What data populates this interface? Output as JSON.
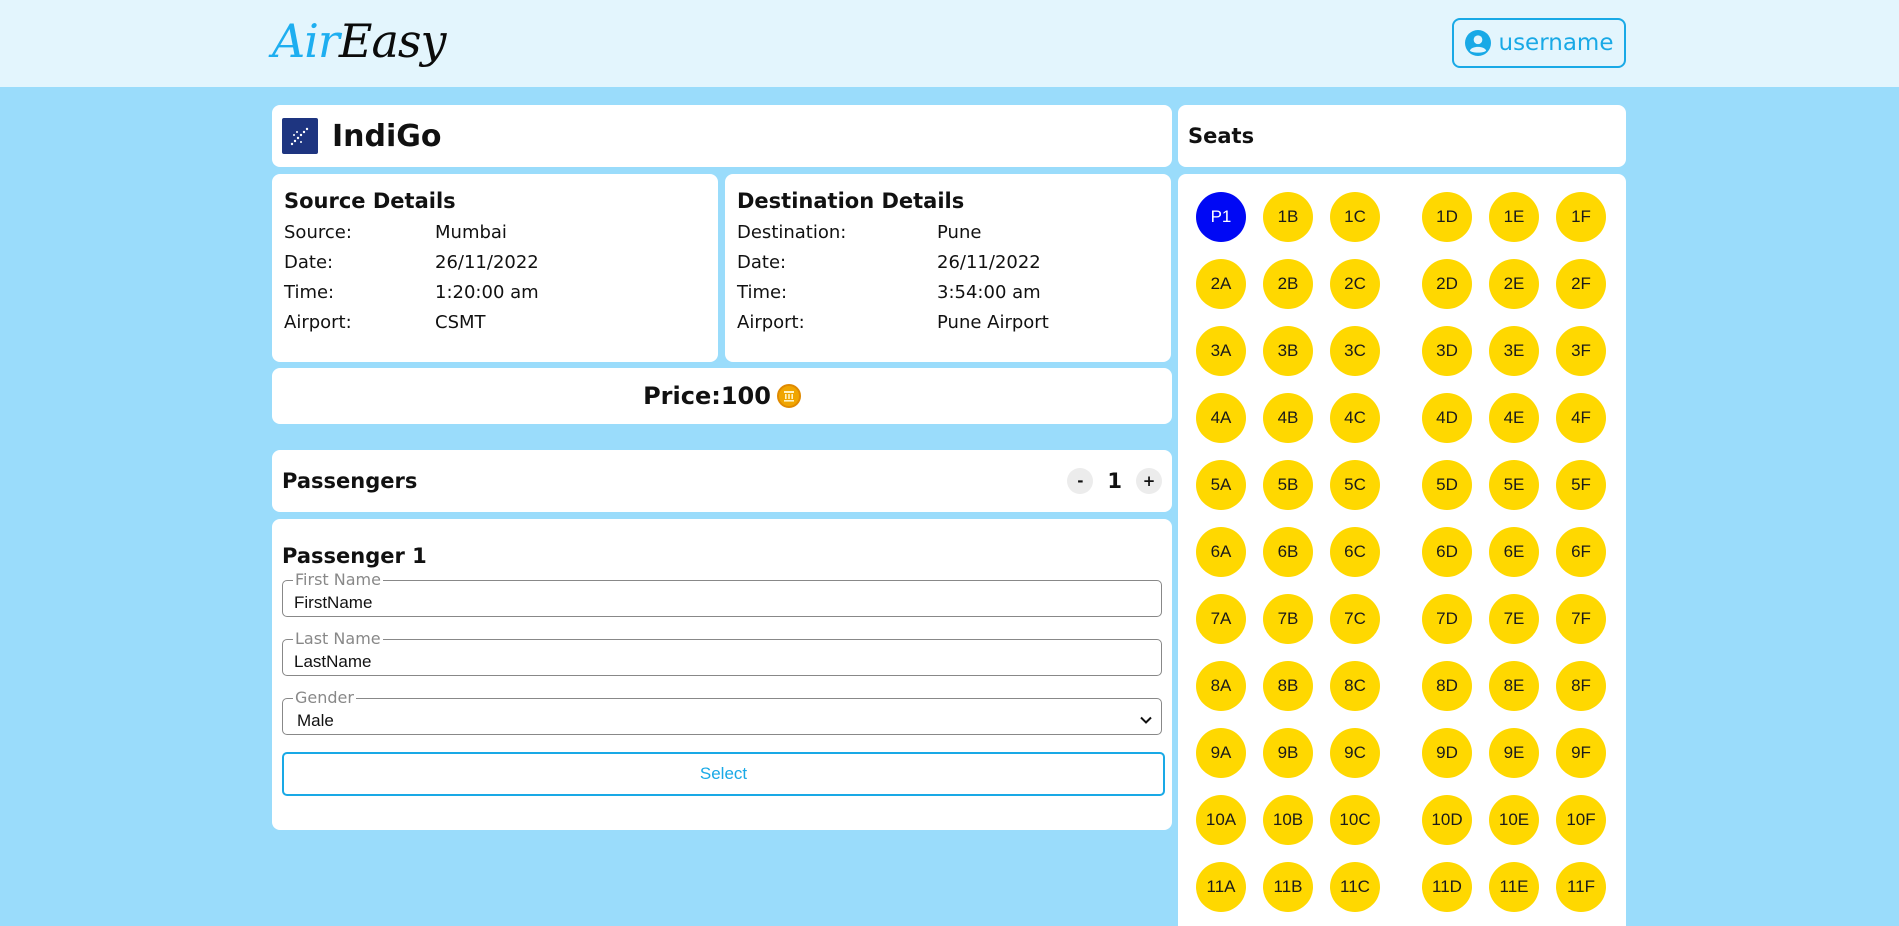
{
  "header": {
    "logo_part1": "Air",
    "logo_part2": "Easy",
    "username": "username"
  },
  "flight": {
    "airline": "IndiGo"
  },
  "source": {
    "title": "Source Details",
    "rows": [
      {
        "label": "Source:",
        "value": "Mumbai"
      },
      {
        "label": "Date:",
        "value": "26/11/2022"
      },
      {
        "label": "Time:",
        "value": "1:20:00 am"
      },
      {
        "label": "Airport:",
        "value": "CSMT"
      }
    ]
  },
  "destination": {
    "title": "Destination Details",
    "rows": [
      {
        "label": "Destination:",
        "value": "Pune"
      },
      {
        "label": "Date:",
        "value": "26/11/2022"
      },
      {
        "label": "Time:",
        "value": "3:54:00 am"
      },
      {
        "label": "Airport:",
        "value": "Pune Airport"
      }
    ]
  },
  "price": {
    "label": "Price:",
    "value": "100"
  },
  "passengers": {
    "title": "Passengers",
    "minus": "-",
    "count": "1",
    "plus": "+"
  },
  "passenger_form": {
    "title": "Passenger 1",
    "first_name_legend": "First Name",
    "first_name_value": "FirstName",
    "last_name_legend": "Last Name",
    "last_name_value": "LastName",
    "gender_legend": "Gender",
    "gender_value": "Male",
    "select_label": "Select"
  },
  "seats": {
    "title": "Seats",
    "rows": [
      [
        "P1",
        "1B",
        "1C",
        "1D",
        "1E",
        "1F"
      ],
      [
        "2A",
        "2B",
        "2C",
        "2D",
        "2E",
        "2F"
      ],
      [
        "3A",
        "3B",
        "3C",
        "3D",
        "3E",
        "3F"
      ],
      [
        "4A",
        "4B",
        "4C",
        "4D",
        "4E",
        "4F"
      ],
      [
        "5A",
        "5B",
        "5C",
        "5D",
        "5E",
        "5F"
      ],
      [
        "6A",
        "6B",
        "6C",
        "6D",
        "6E",
        "6F"
      ],
      [
        "7A",
        "7B",
        "7C",
        "7D",
        "7E",
        "7F"
      ],
      [
        "8A",
        "8B",
        "8C",
        "8D",
        "8E",
        "8F"
      ],
      [
        "9A",
        "9B",
        "9C",
        "9D",
        "9E",
        "9F"
      ],
      [
        "10A",
        "10B",
        "10C",
        "10D",
        "10E",
        "10F"
      ],
      [
        "11A",
        "11B",
        "11C",
        "11D",
        "11E",
        "11F"
      ]
    ],
    "selected": [
      "P1"
    ],
    "available_color": "#ffd800",
    "selected_color": "#0008f5"
  }
}
